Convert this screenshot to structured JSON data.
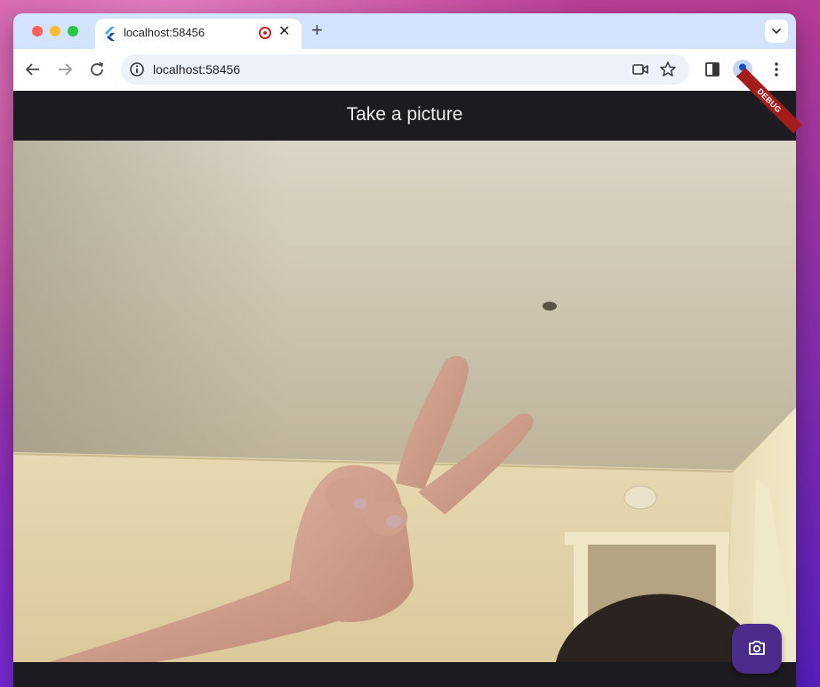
{
  "browser": {
    "tab": {
      "title": "localhost:58456",
      "close_glyph": "✕",
      "favicon": "flutter-logo-icon",
      "recording_indicator": "recording-icon"
    },
    "new_tab_glyph": "+",
    "address_bar": {
      "url": "localhost:58456"
    },
    "toolbar_icons": [
      "back-arrow-icon",
      "forward-arrow-icon",
      "reload-icon",
      "site-info-icon",
      "camera-in-use-icon",
      "bookmark-star-icon",
      "side-panel-icon",
      "profile-avatar-icon",
      "more-menu-icon"
    ]
  },
  "app": {
    "title": "Take a picture",
    "debug_banner": "DEBUG",
    "fab_icon": "camera-icon"
  },
  "colors": {
    "appbar": "#1c1b1f",
    "fab": "#4a2d8a",
    "tabstrip": "#d3e3fd"
  }
}
